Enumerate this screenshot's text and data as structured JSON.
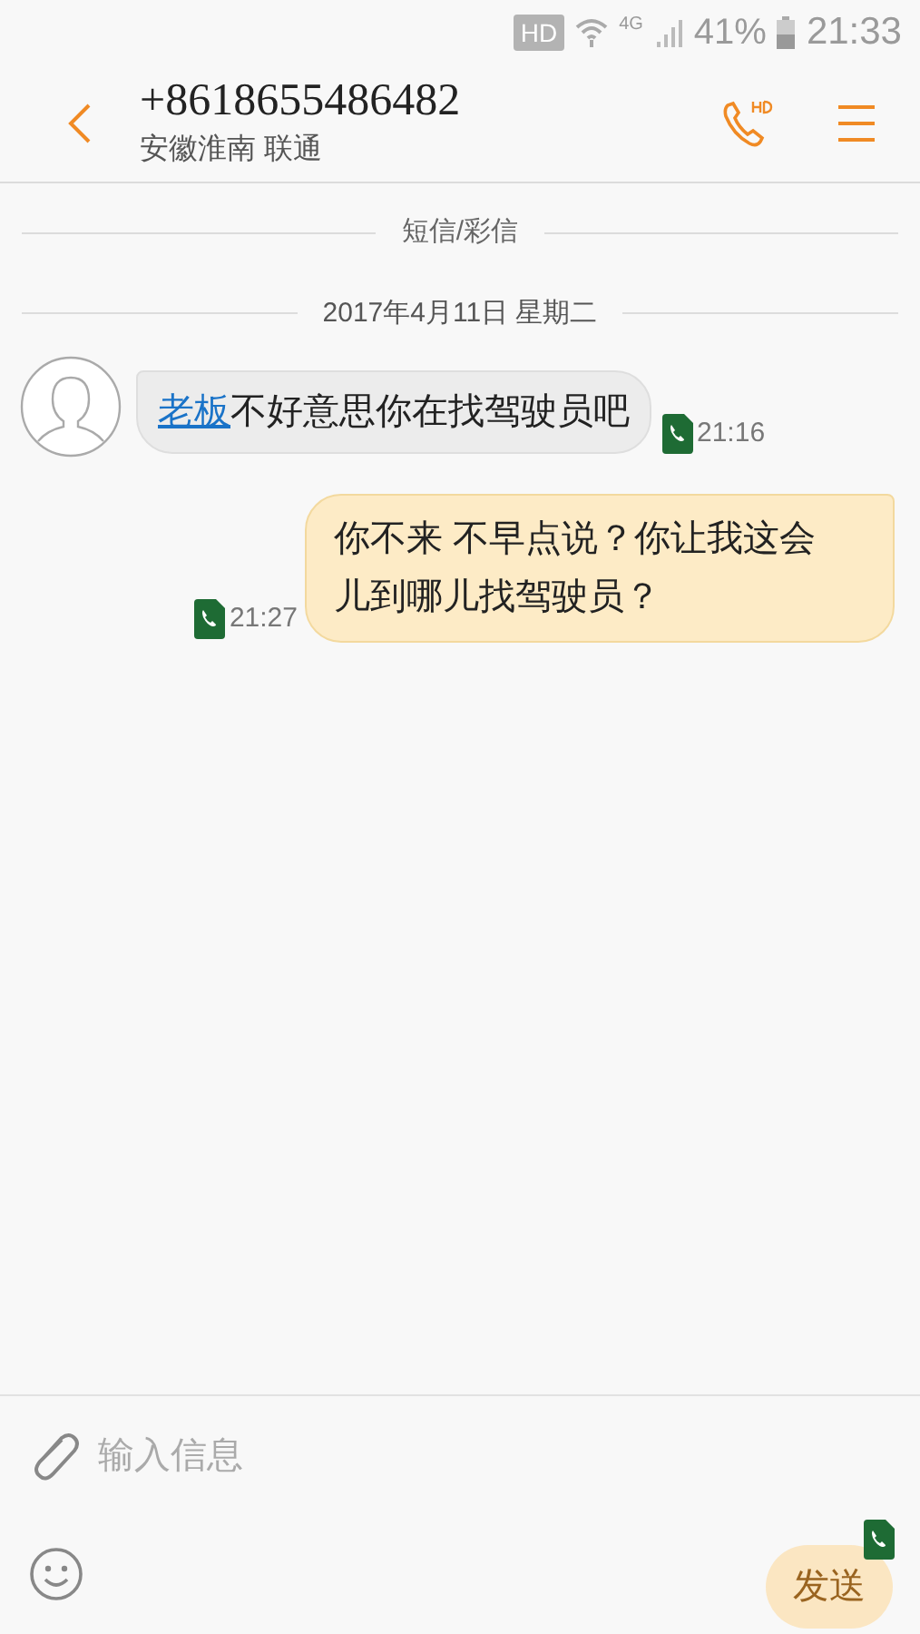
{
  "status_bar": {
    "hd_badge": "HD",
    "network": "4G",
    "battery": "41%",
    "time": "21:33"
  },
  "header": {
    "phone_number": "+8618655486482",
    "location": "安徽淮南 联通"
  },
  "channel_label": "短信/彩信",
  "date": "2017年4月11日 星期二",
  "messages": [
    {
      "kind": "incoming",
      "link": "老板",
      "text": "不好意思你在找驾驶员吧",
      "time": "21:16"
    },
    {
      "kind": "outgoing",
      "text": "你不来 不早点说？你让我这会儿到哪儿找驾驶员？",
      "time": "21:27"
    }
  ],
  "composer": {
    "placeholder": "输入信息",
    "send_label": "发送"
  }
}
